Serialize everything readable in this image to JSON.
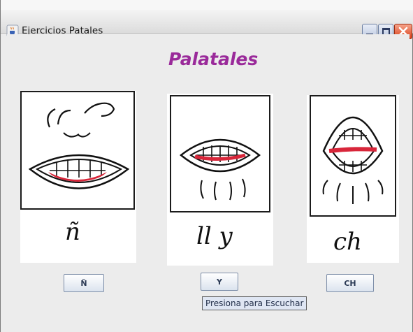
{
  "window": {
    "title": "Ejercicios Patales",
    "icons": {
      "app": "java-cup-icon",
      "minimize": "minimize-icon",
      "maximize": "maximize-icon",
      "close": "close-icon"
    }
  },
  "heading": "Palatales",
  "cards": [
    {
      "image": "nose-mouth-illustration",
      "letter": "ñ"
    },
    {
      "image": "lips-vibration-illustration",
      "letter": "ll y"
    },
    {
      "image": "open-mouth-air-illustration",
      "letter": "ch"
    }
  ],
  "buttons": [
    {
      "label": "Ñ"
    },
    {
      "label": "Y"
    },
    {
      "label": "CH"
    }
  ],
  "tooltip": "Presiona para Escuchar",
  "colors": {
    "heading": "#9a2a9a",
    "lips_accent": "#d8263a",
    "tooltip_bg": "#dfe6f3"
  }
}
